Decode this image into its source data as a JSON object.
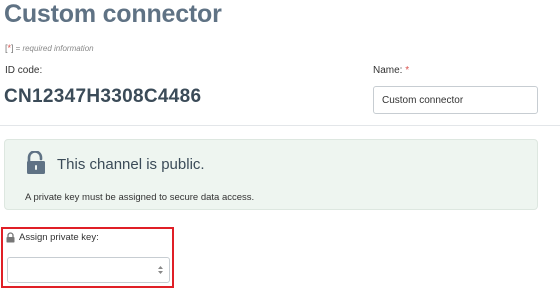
{
  "page": {
    "title": "Custom connector",
    "required_note": "= required information",
    "required_marker": "*"
  },
  "id_field": {
    "label": "ID code:",
    "value": "CN12347H3308C4486"
  },
  "name_field": {
    "label": "Name:",
    "required_star": "*",
    "value": "Custom connector"
  },
  "channel_panel": {
    "title": "This channel is public.",
    "description": "A private key must be assigned to secure data access.",
    "icon": "unlocked-padlock-icon"
  },
  "assign_key": {
    "label": "Assign private key:",
    "selected_value": "",
    "icon": "padlock-icon"
  },
  "colors": {
    "title": "#5f7284",
    "required": "#d9534f",
    "panel_bg": "#eef5f0",
    "highlight_border": "#e01f26"
  }
}
